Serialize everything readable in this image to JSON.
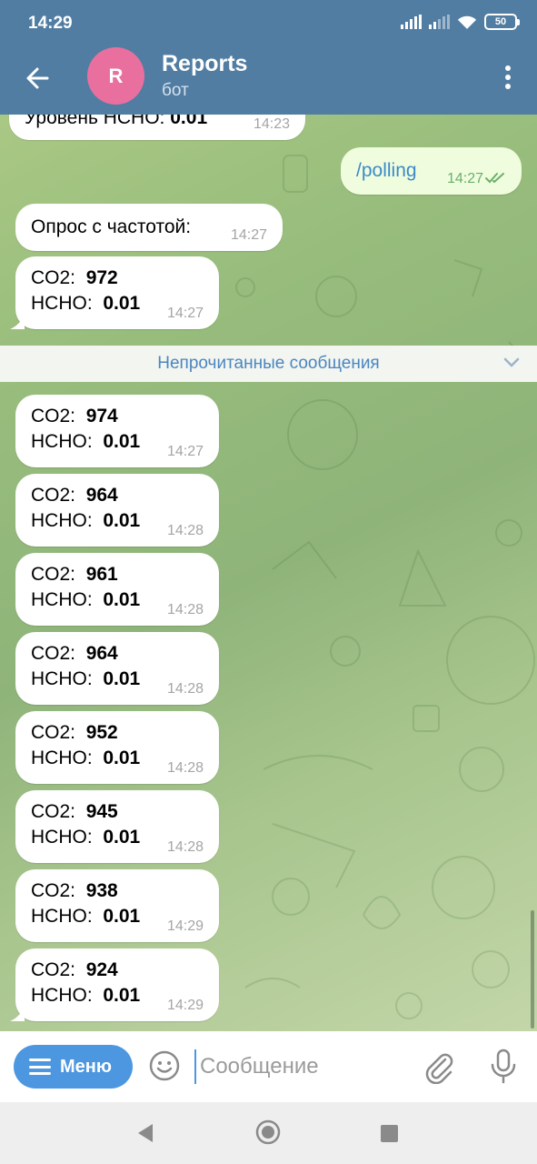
{
  "status_bar": {
    "time": "14:29",
    "battery": "50"
  },
  "header": {
    "avatar_letter": "R",
    "title": "Reports",
    "subtitle": "бот"
  },
  "chat": {
    "partial_message": {
      "label": "Уровень HCHO:",
      "value": "0.01",
      "time": "14:23"
    },
    "outgoing": {
      "text": "/polling",
      "time": "14:27"
    },
    "poll_message": {
      "text": "Опрос с частотой:",
      "time": "14:27"
    },
    "unread_label": "Непрочитанные сообщения",
    "readings": [
      {
        "co2_label": "CO2:",
        "co2": "972",
        "hcho_label": "HCHO:",
        "hcho": "0.01",
        "time": "14:27"
      },
      {
        "co2_label": "CO2:",
        "co2": "974",
        "hcho_label": "HCHO:",
        "hcho": "0.01",
        "time": "14:27"
      },
      {
        "co2_label": "CO2:",
        "co2": "964",
        "hcho_label": "HCHO:",
        "hcho": "0.01",
        "time": "14:28"
      },
      {
        "co2_label": "CO2:",
        "co2": "961",
        "hcho_label": "HCHO:",
        "hcho": "0.01",
        "time": "14:28"
      },
      {
        "co2_label": "CO2:",
        "co2": "964",
        "hcho_label": "HCHO:",
        "hcho": "0.01",
        "time": "14:28"
      },
      {
        "co2_label": "CO2:",
        "co2": "952",
        "hcho_label": "HCHO:",
        "hcho": "0.01",
        "time": "14:28"
      },
      {
        "co2_label": "CO2:",
        "co2": "945",
        "hcho_label": "HCHO:",
        "hcho": "0.01",
        "time": "14:28"
      },
      {
        "co2_label": "CO2:",
        "co2": "938",
        "hcho_label": "HCHO:",
        "hcho": "0.01",
        "time": "14:29"
      },
      {
        "co2_label": "CO2:",
        "co2": "924",
        "hcho_label": "HCHO:",
        "hcho": "0.01",
        "time": "14:29"
      }
    ]
  },
  "input_bar": {
    "menu_label": "Меню",
    "placeholder": "Сообщение"
  },
  "colors": {
    "header": "#517da2",
    "avatar": "#e9709e",
    "accent": "#4c97e0",
    "outgoing_bubble": "#effdde"
  },
  "icons": [
    "back-arrow-icon",
    "more-vertical-icon",
    "double-check-icon",
    "chevron-down-icon",
    "emoji-icon",
    "attach-icon",
    "microphone-icon"
  ]
}
